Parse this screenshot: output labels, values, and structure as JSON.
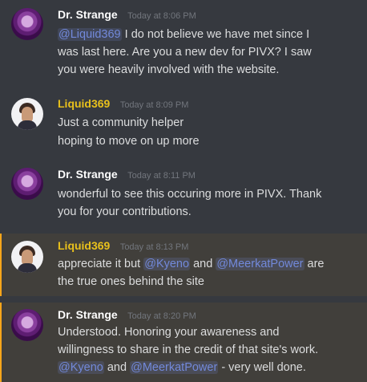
{
  "colors": {
    "background": "#36393f",
    "highlight_background": "#413f3b",
    "highlight_bar": "#faa61a",
    "mention": "#7289da",
    "liquid_name": "#e8c01c"
  },
  "messages": [
    {
      "author": "Dr. Strange",
      "timestamp": "Today at 8:06 PM",
      "lines": {
        "l1_mention": "@Liquid369",
        "l1_text": " I do not believe we have met since I",
        "l2": "was last here. Are you a new dev for PIVX?  I saw",
        "l3": "you were heavily involved with the website."
      }
    },
    {
      "author": "Liquid369",
      "timestamp": "Today at 8:09 PM",
      "lines": {
        "l1": "Just a community helper",
        "l2": "hoping to move on up more"
      }
    },
    {
      "author": "Dr. Strange",
      "timestamp": "Today at 8:11 PM",
      "lines": {
        "l1": "wonderful to see this occuring more in PIVX.  Thank",
        "l2": "you for your contributions."
      }
    },
    {
      "author": "Liquid369",
      "timestamp": "Today at 8:13 PM",
      "lines": {
        "l1_text_a": "appreciate it but ",
        "l1_mention_a": "@Kyeno",
        "l1_text_b": " and ",
        "l1_mention_b": "@MeerkatPower",
        "l1_text_c": " are",
        "l2": "the true ones behind the site"
      }
    },
    {
      "author": "Dr. Strange",
      "timestamp": "Today at 8:20 PM",
      "lines": {
        "l1": "Understood.  Honoring your awareness and",
        "l2": "willingness to share in the credit of that site's work.",
        "l3_mention_a": "@Kyeno",
        "l3_text_a": " and ",
        "l3_mention_b": "@MeerkatPower",
        "l3_text_b": " - very well done."
      }
    }
  ]
}
